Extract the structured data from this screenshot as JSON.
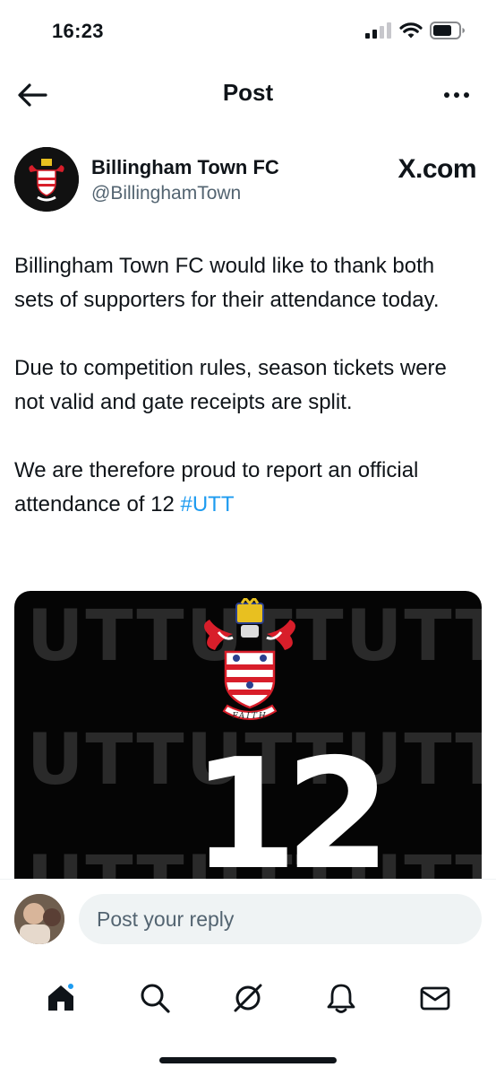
{
  "status_bar": {
    "time": "16:23",
    "signal_icon": "cellular-signal-icon",
    "wifi_icon": "wifi-icon",
    "battery_icon": "battery-icon"
  },
  "header": {
    "title": "Post",
    "back_icon": "back-arrow-icon",
    "more_icon": "more-options-icon"
  },
  "author": {
    "name": "Billingham Town FC",
    "handle": "@BillinghamTown",
    "watermark": "X.com"
  },
  "post": {
    "paragraphs": [
      "Billingham Town FC would like to thank both sets of supporters for their attendance today.",
      "Due to competition rules, season tickets were not valid and gate receipts are split.",
      "We are therefore proud to report an official attendance of 12"
    ],
    "hashtag": "#UTT",
    "image": {
      "background_text": "UTT",
      "number": "12",
      "crest_motto": "FAITH"
    }
  },
  "reply": {
    "placeholder": "Post your reply"
  },
  "tabs": [
    {
      "icon": "home-icon",
      "has_notification": true
    },
    {
      "icon": "search-icon"
    },
    {
      "icon": "grok-icon"
    },
    {
      "icon": "notifications-bell-icon"
    },
    {
      "icon": "messages-envelope-icon"
    }
  ],
  "colors": {
    "accent": "#1d9bf0",
    "text": "#0f1419",
    "secondary_text": "#536471",
    "crest_red": "#d81e2a"
  }
}
